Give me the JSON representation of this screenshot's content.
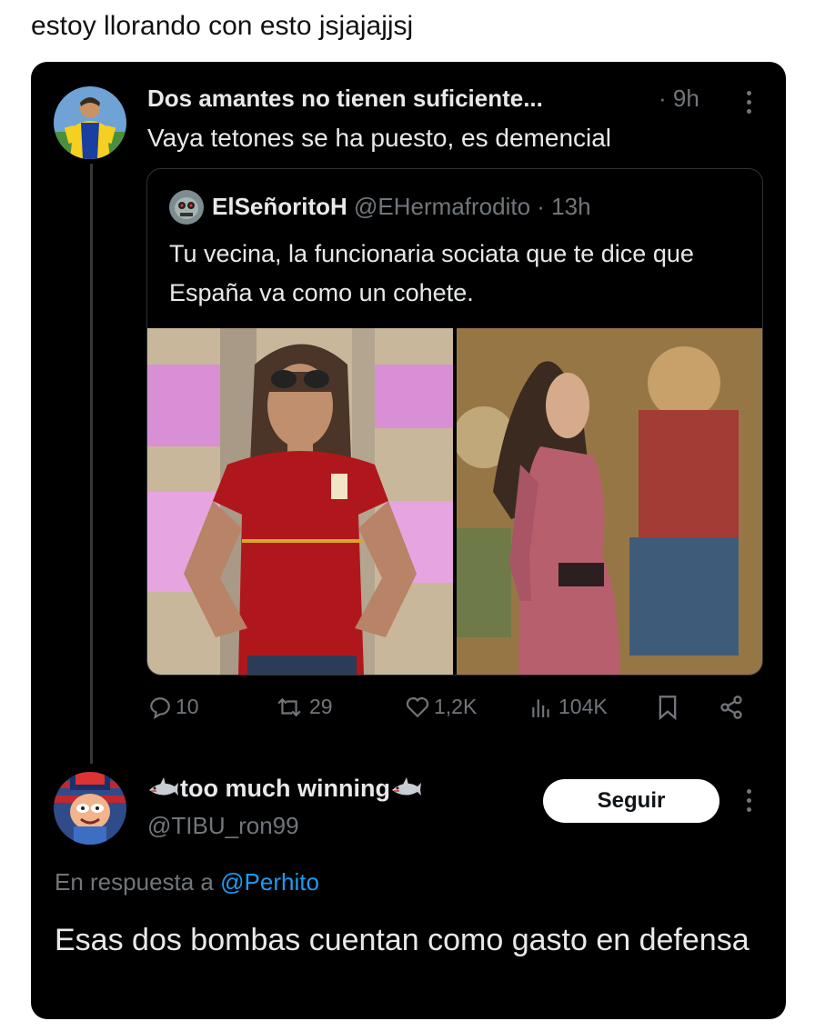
{
  "post": {
    "caption": "estoy llorando con esto jsjajajjsj"
  },
  "tweet_main": {
    "author_name": "Dos amantes no tienen suficiente...",
    "time": "· 9h",
    "text": "Vaya tetones se ha puesto, es demencial",
    "avatar_icon": "soccer-player-avatar",
    "more_icon": "more-vertical-icon"
  },
  "quoted_tweet": {
    "author_name": "ElSeñoritoH",
    "handle": "@EHermafrodito",
    "time": "· 13h",
    "text": "Tu vecina, la funcionaria sociata que te dice que España va como un cohete.",
    "images": [
      "photo-woman-red-shirt",
      "photo-woman-pink-dress-tapestry"
    ]
  },
  "actions": {
    "replies": "10",
    "retweets": "29",
    "likes": "1,2K",
    "views": "104K",
    "bookmark_icon": "bookmark-icon",
    "share_icon": "share-icon"
  },
  "reply_tweet": {
    "author_name": "too much winning",
    "name_emoji": "shark",
    "handle": "@TIBU_ron99",
    "follow_label": "Seguir",
    "reply_prefix": "En respuesta a ",
    "reply_mention": "@Perhito",
    "text": "Esas dos bombas cuentan como gasto en defensa"
  },
  "colors": {
    "background": "#000000",
    "text_primary": "#e7e9ea",
    "text_secondary": "#71767b",
    "mention": "#1d9bf0",
    "border": "#2f3336"
  }
}
